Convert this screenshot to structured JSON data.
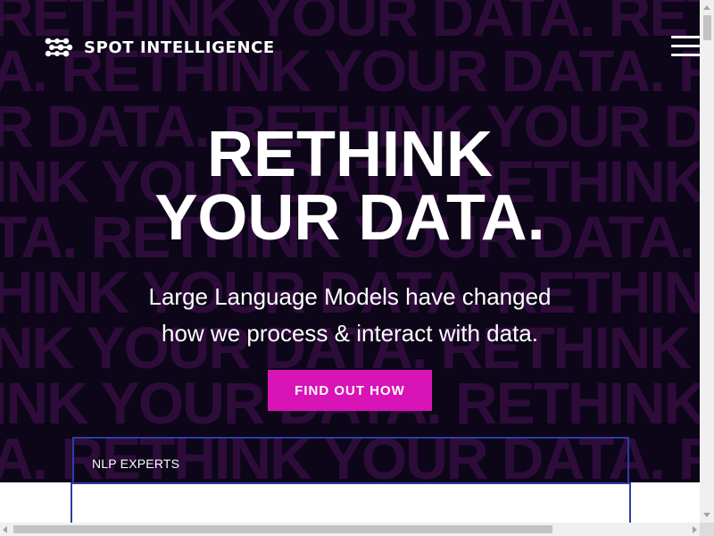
{
  "header": {
    "brand": "SPOT INTELLIGENCE",
    "logo_icon": "molecule-logo-icon",
    "menu_icon": "hamburger-menu-icon"
  },
  "hero": {
    "background_text_lines": [
      "RETHINK YOUR DATA. RETHINK",
      "A. RETHINK YOUR DATA. RETH",
      "R DATA. RETHINK YOUR DATA.",
      "INK YOUR DATA. RETHINK YOU",
      "TA. RETHINK YOUR DATA. RETH",
      "HINK YOUR DATA. RETHINK YOUR",
      "NK YOUR DATA. RETHINK YOUR",
      "INK YOUR DATA. RETHINK YO",
      "A. RETHINK YOUR DATA. RETHINK"
    ],
    "headline_line1": "RETHINK",
    "headline_line2": "YOUR DATA.",
    "subtitle_line1": "Large Language Models have changed",
    "subtitle_line2": "how we process & interact with data.",
    "cta_label": "FIND OUT HOW"
  },
  "section": {
    "experts_label": "NLP EXPERTS"
  },
  "colors": {
    "hero_background": "#0c0618",
    "pattern_text": "#2d0c3a",
    "accent": "#d814b6",
    "box_border": "#2d3ea8"
  }
}
